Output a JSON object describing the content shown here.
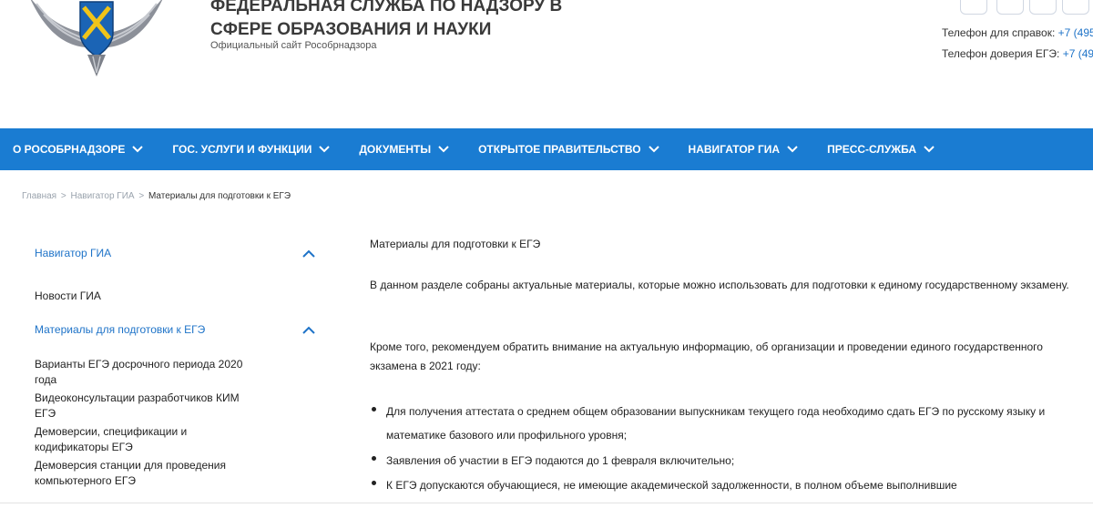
{
  "header": {
    "title_lines": [
      "Федеральная служба по надзору в",
      "сфере образования и науки"
    ],
    "subtitle": "Официальный сайт Рособрнадзора",
    "contacts": [
      {
        "label": "Телефон для справок:",
        "phone": "+7 (495"
      },
      {
        "label": "Телефон доверия ЕГЭ:",
        "phone": "+7 (495"
      }
    ]
  },
  "nav": {
    "items": [
      {
        "label": "О РОСОБРНАДЗОРЕ"
      },
      {
        "label": "ГОС. УСЛУГИ И ФУНКЦИИ"
      },
      {
        "label": "ДОКУМЕНТЫ"
      },
      {
        "label": "ОТКРЫТОЕ ПРАВИТЕЛЬСТВО"
      },
      {
        "label": "НАВИГАТОР ГИА"
      },
      {
        "label": "ПРЕСС-СЛУЖБА"
      }
    ]
  },
  "breadcrumb": {
    "home": "Главная",
    "section": "Навигатор ГИА",
    "current": "Материалы для подготовки к ЕГЭ",
    "separator": ">"
  },
  "sidebar": {
    "items": [
      {
        "label": "Навигатор ГИА"
      },
      {
        "label": "Новости ГИА"
      },
      {
        "label": "Материалы для подготовки к ЕГЭ"
      },
      {
        "label": "Варианты ЕГЭ досрочного периода 2020 года"
      },
      {
        "label": "Видеоконсультации разработчиков КИМ ЕГЭ"
      },
      {
        "label": "Демоверсии, спецификации и кодификаторы ЕГЭ"
      },
      {
        "label": "Демоверсия станции для проведения компьютерного ЕГЭ"
      }
    ]
  },
  "content": {
    "heading": "Материалы для подготовки к ЕГЭ",
    "intro": "В данном разделе собраны актуальные материалы, которые можно использовать для подготовки к единому государственному экзамену.",
    "note": "Кроме того, рекомендуем обратить внимание на актуальную информацию, об организации и проведении единого государственного экзамена в 2021 году:",
    "bullets": [
      "Для получения аттестата о среднем общем образовании выпускникам текущего года необходимо сдать ЕГЭ по русскому языку и математике базового или профильного уровня;",
      "Заявления об участии в ЕГЭ подаются до 1 февраля включительно;",
      "К ЕГЭ допускаются обучающиеся, не  имеющие академической задолженности, в полном объеме выполнившие"
    ]
  },
  "colors": {
    "nav_bg": "#1a7cd2",
    "link": "#1e73c8",
    "text": "#222222"
  },
  "icons": {
    "emblem": "eagle-emblem-icon",
    "nav_chevron": "chevron-down-icon",
    "sidebar_chevron": "chevron-up-icon"
  }
}
